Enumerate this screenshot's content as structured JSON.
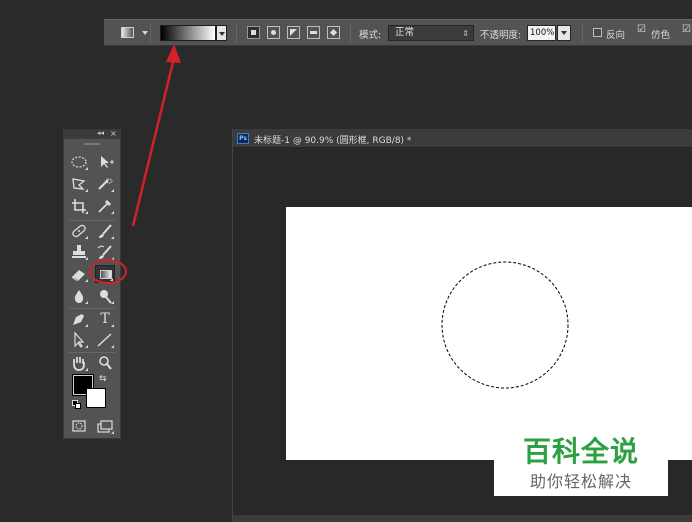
{
  "options_bar": {
    "mode_label": "模式:",
    "mode_value": "正常",
    "opacity_label": "不透明度:",
    "opacity_value": "100%",
    "reverse_label": "反向",
    "dither_label": "仿色",
    "dither_checked": true,
    "reverse_checked": false,
    "gradient_colors": [
      "#000000",
      "#ffffff"
    ]
  },
  "tools_panel": {
    "collapse_glyph": "◂◂",
    "close_glyph": "×",
    "fg_color": "#000000",
    "bg_color": "#ffffff",
    "text_tool_glyph": "T"
  },
  "document": {
    "ps_badge": "Ps",
    "title": "未标题-1 @ 90.9% (圆形框, RGB/8) *",
    "canvas_color": "#ffffff"
  },
  "annotation": {
    "arrow_color": "#d3202a"
  },
  "watermark": {
    "title": "百科全说",
    "subtitle": "助你轻松解决"
  }
}
